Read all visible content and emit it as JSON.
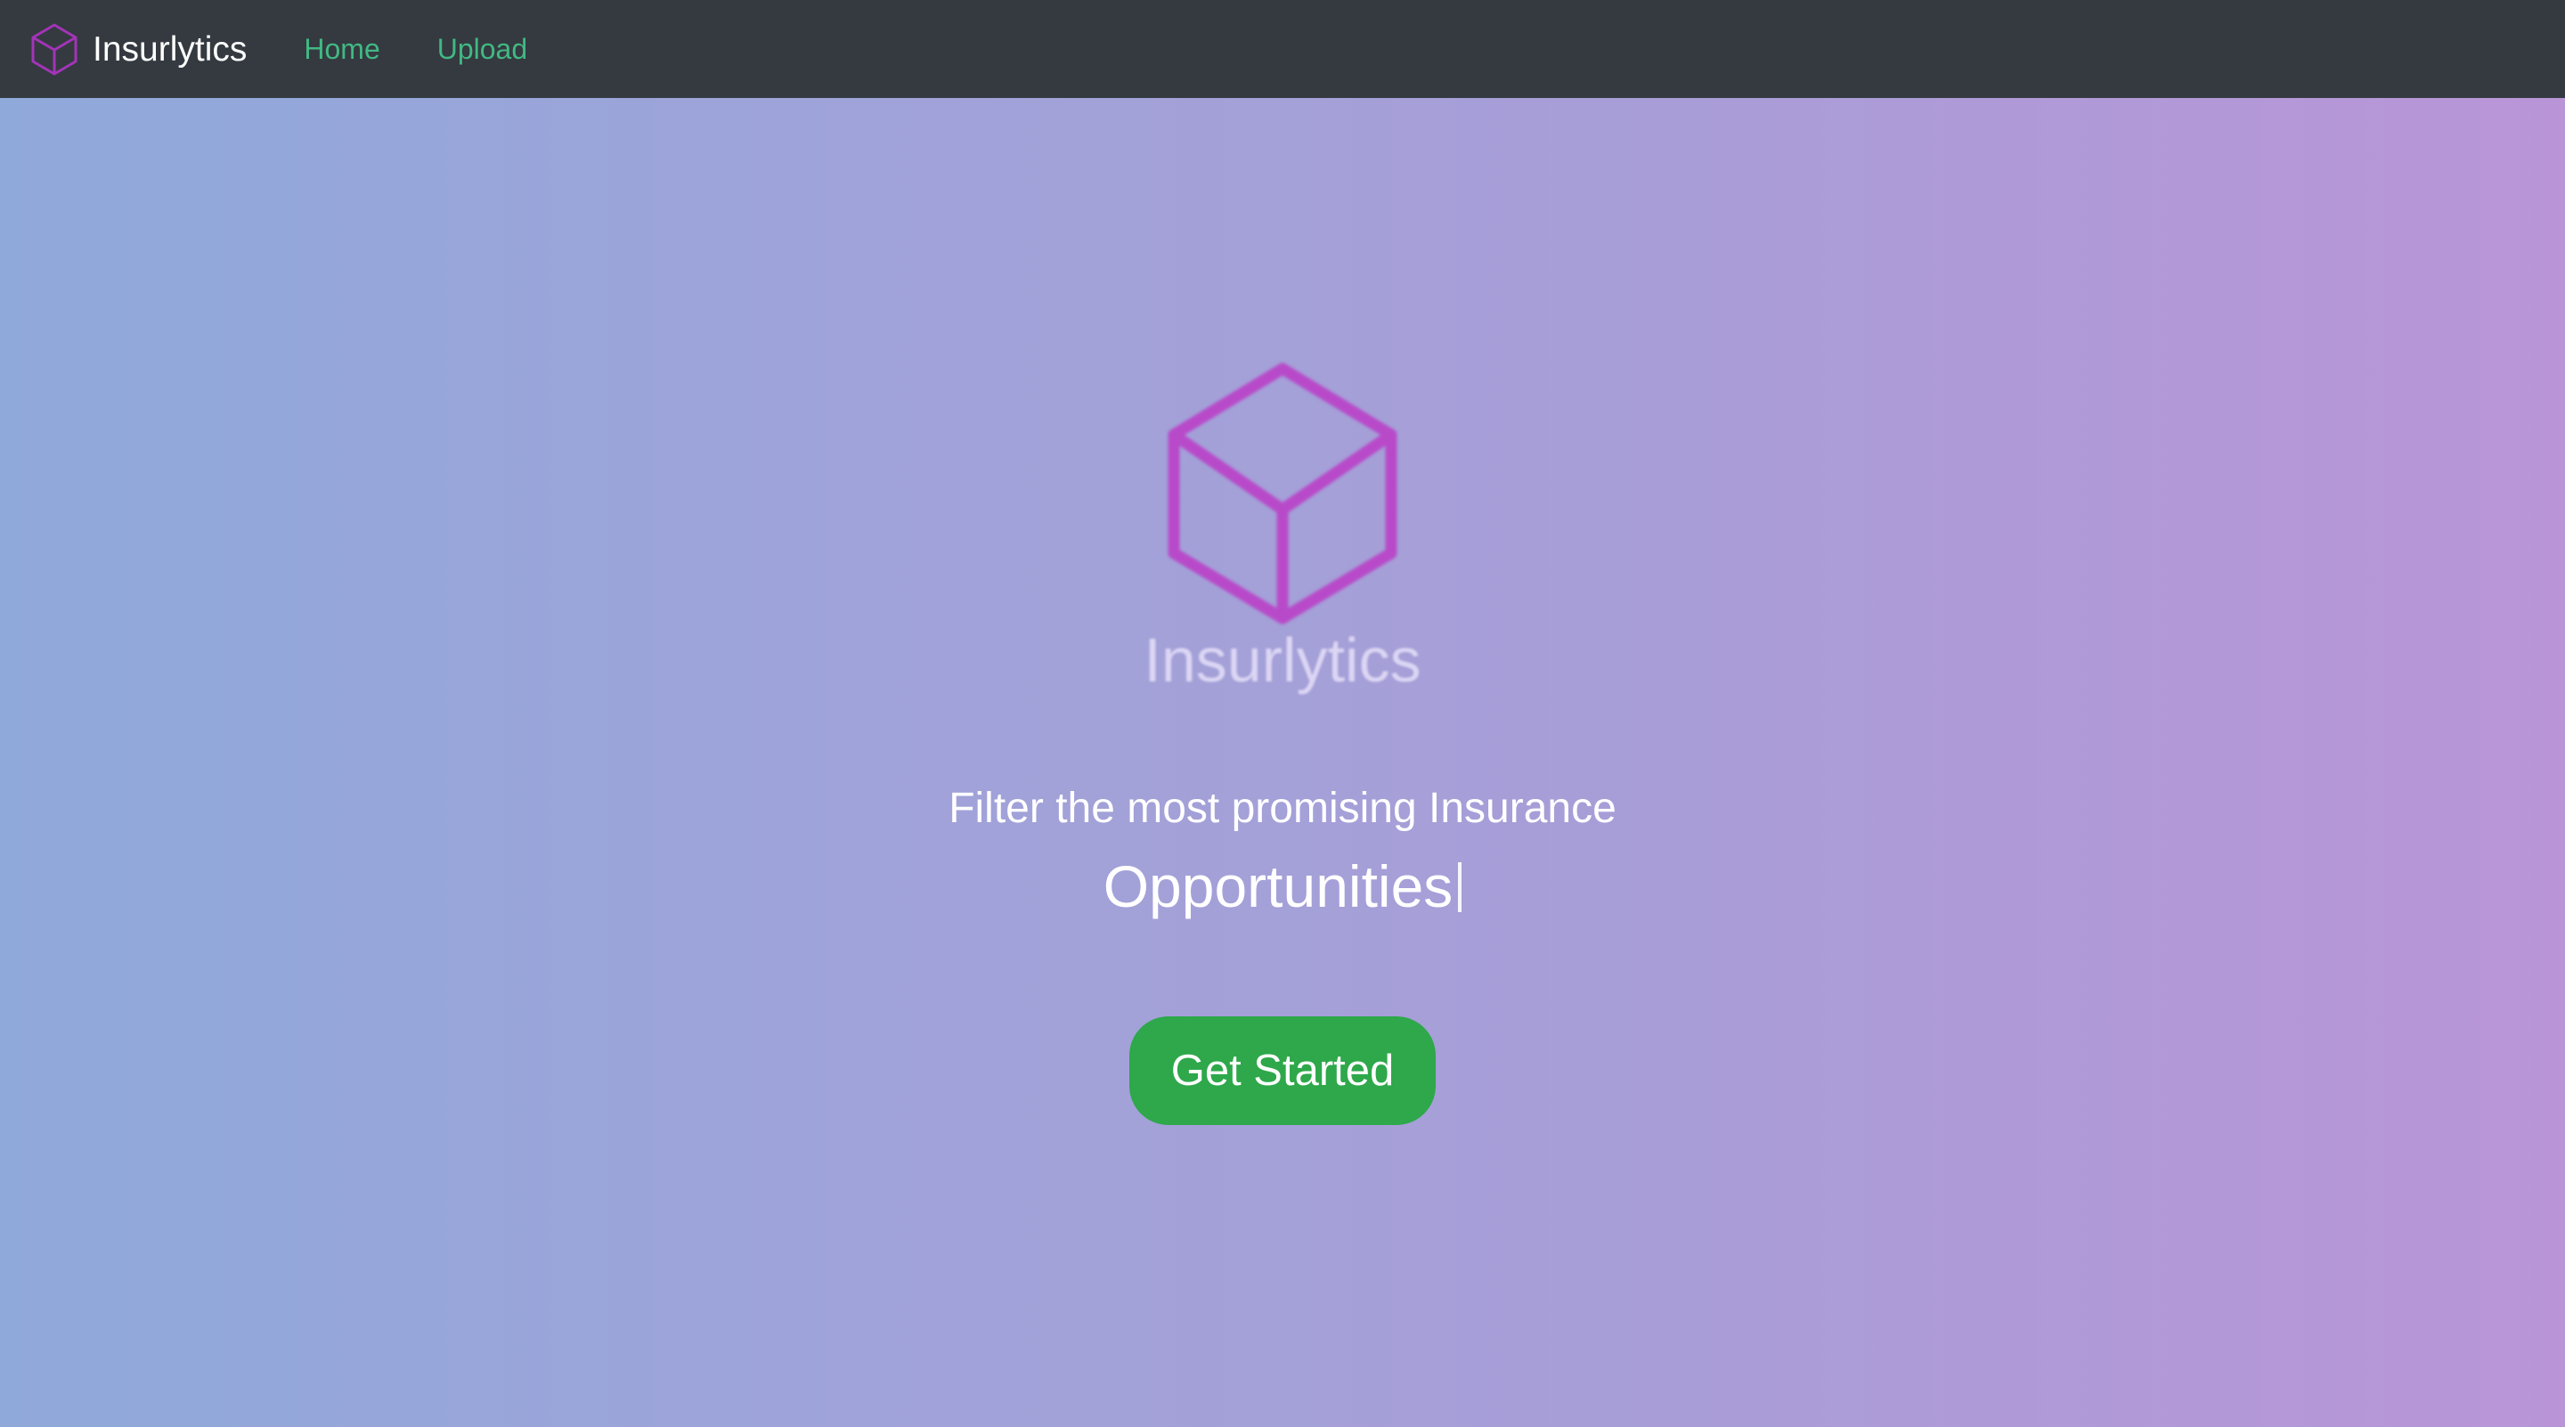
{
  "navbar": {
    "brand": "Insurlytics",
    "brand_icon": "cube-icon",
    "links": [
      {
        "label": "Home"
      },
      {
        "label": "Upload"
      }
    ],
    "background_color": "#343a40",
    "link_color": "#42b883"
  },
  "hero": {
    "logo_icon": "cube-icon",
    "logo_color": "#b84ac9",
    "logo_text": "Insurlytics",
    "tagline": "Filter the most promising Insurance",
    "typed_word": "Opportunities",
    "cta_label": "Get Started",
    "cta_color": "#2ea84a",
    "gradient": [
      "#8fa9da",
      "#b995d7"
    ]
  }
}
